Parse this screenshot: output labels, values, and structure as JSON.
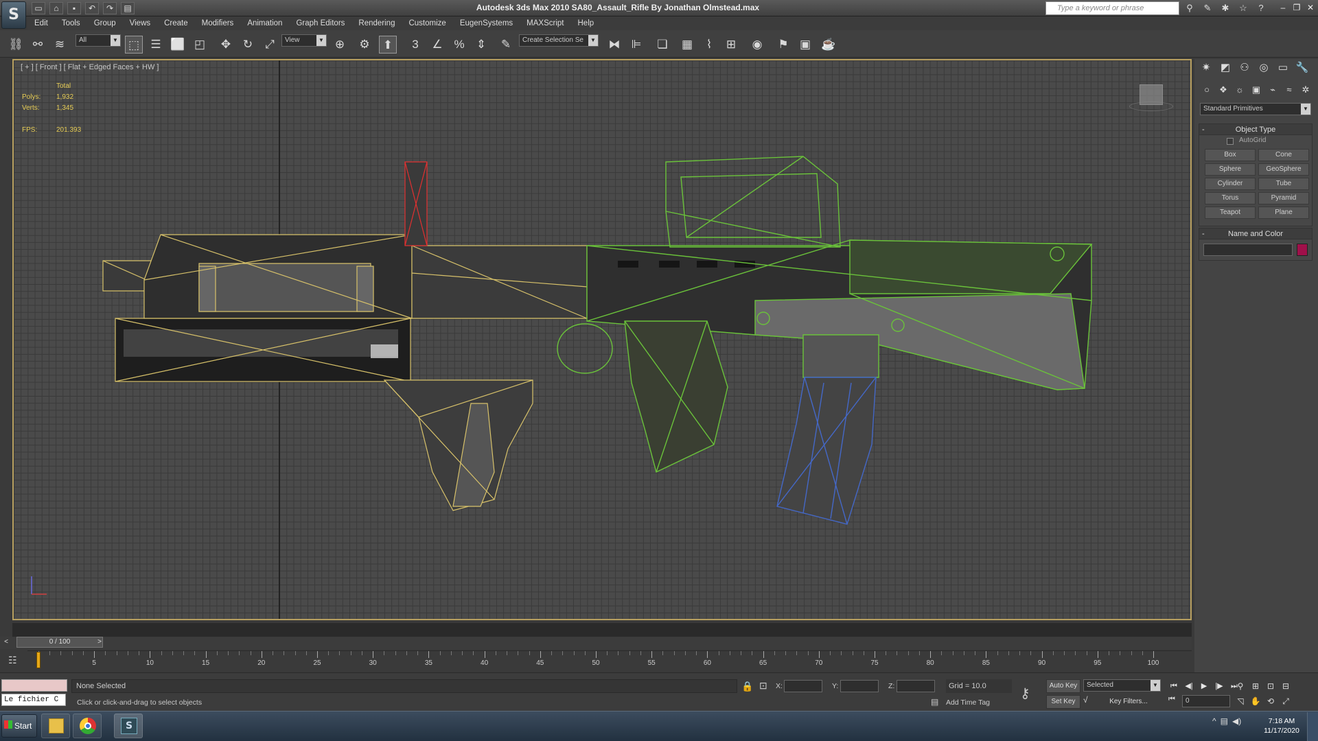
{
  "titlebar": {
    "app_logo_letter": "S",
    "window_title": "Autodesk 3ds Max  2010      SA80_Assault_Rifle By Jonathan Olmstead.max",
    "search_placeholder": "Type a keyword or phrase"
  },
  "menu": [
    "Edit",
    "Tools",
    "Group",
    "Views",
    "Create",
    "Modifiers",
    "Animation",
    "Graph Editors",
    "Rendering",
    "Customize",
    "EugenSystems",
    "MAXScript",
    "Help"
  ],
  "toolbar": {
    "filter_value": "All",
    "coord_value": "View",
    "selection_set_value": "Create Selection Se"
  },
  "viewport": {
    "label": "[ + ] [ Front ] [ Flat + Edged Faces + HW ]",
    "stats_header": "Total",
    "polys_label": "Polys:",
    "polys_value": "1,932",
    "verts_label": "Verts:",
    "verts_value": "1,345",
    "fps_label": "FPS:",
    "fps_value": "201.393"
  },
  "command_panel": {
    "primitive_type": "Standard Primitives",
    "object_type_title": "Object Type",
    "autogrid_label": "AutoGrid",
    "buttons": [
      "Box",
      "Cone",
      "Sphere",
      "GeoSphere",
      "Cylinder",
      "Tube",
      "Torus",
      "Pyramid",
      "Teapot",
      "Plane"
    ],
    "name_color_title": "Name and Color",
    "object_color": "#a0104a"
  },
  "timeline": {
    "slider_text": "0 / 100",
    "ticks": [
      "5",
      "10",
      "15",
      "20",
      "25",
      "30",
      "35",
      "40",
      "45",
      "50",
      "55",
      "60",
      "65",
      "70",
      "75",
      "80",
      "85",
      "90",
      "95",
      "100"
    ]
  },
  "status": {
    "maxscript_text": "Le fichier C",
    "selection_text": "None Selected",
    "prompt_text": "Click or click-and-drag to select objects",
    "x_label": "X:",
    "y_label": "Y:",
    "z_label": "Z:",
    "grid_text": "Grid = 10.0",
    "add_time_tag": "Add Time Tag",
    "auto_key": "Auto Key",
    "set_key": "Set Key",
    "selected_value": "Selected",
    "key_filters": "Key Filters...",
    "frame_value": "0"
  },
  "taskbar": {
    "start_label": "Start",
    "time": "7:18 AM",
    "date": "11/17/2020"
  }
}
